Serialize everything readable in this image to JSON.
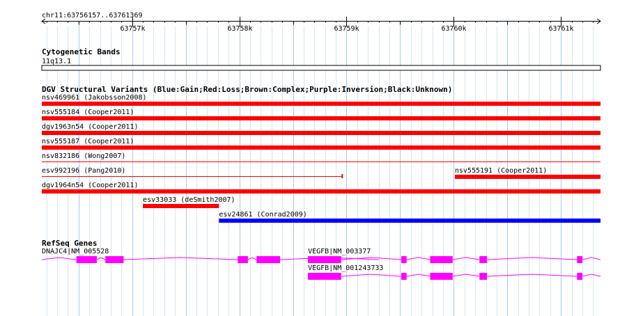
{
  "ruler": {
    "label": "chr11:63756157..63761369",
    "ticks": [
      {
        "value": 63757000,
        "label": "63757k"
      },
      {
        "value": 63758000,
        "label": "63758k"
      },
      {
        "value": 63759000,
        "label": "63759k"
      },
      {
        "value": 63760000,
        "label": "63760k"
      },
      {
        "value": 63761000,
        "label": "63761k"
      }
    ],
    "start": 63756157,
    "end": 63761369
  },
  "cytoband": {
    "title": "Cytogenetic Bands",
    "band_label": "11q13.1"
  },
  "dgv": {
    "title": "DGV Structural Variants (Blue:Gain;Red:Loss;Brown:Complex;Purple:Inversion;Black:Unknown)",
    "variants": [
      {
        "label": "nsv469961 (Jakobsson2008)",
        "color": "#ff0000",
        "start": 63756157,
        "end": 63761369,
        "style": "thick"
      },
      {
        "label": "nsv555184 (Cooper2011)",
        "color": "#ff0000",
        "start": 63756157,
        "end": 63761369,
        "style": "thick"
      },
      {
        "label": "dgv1963n54 (Cooper2011)",
        "color": "#ff0000",
        "start": 63756157,
        "end": 63761369,
        "style": "thick"
      },
      {
        "label": "nsv555187 (Cooper2011)",
        "color": "#ff0000",
        "start": 63756157,
        "end": 63761369,
        "style": "thick"
      },
      {
        "label": "nsv832186 (Wong2007)",
        "color": "#ff0000",
        "start": 63756157,
        "end": 63761369,
        "style": "thin"
      },
      {
        "label": "esv992196 (Pang2010)",
        "color": "#ff0000",
        "start": 63756157,
        "end": 63758960,
        "style": "line"
      },
      {
        "label": "nsv555191 (Cooper2011)",
        "color": "#ff0000",
        "start": 63760010,
        "end": 63761369,
        "style": "thick"
      },
      {
        "label": "dgv1964n54 (Cooper2011)",
        "color": "#ff0000",
        "start": 63756157,
        "end": 63761369,
        "style": "thick"
      },
      {
        "label": "esv33033 (deSmith2007)",
        "color": "#ff0000",
        "start": 63757100,
        "end": 63757810,
        "style": "thick"
      },
      {
        "label": "esv24861 (Conrad2009)",
        "color": "#0000ff",
        "start": 63757810,
        "end": 63761369,
        "style": "thick"
      }
    ]
  },
  "refseq": {
    "title": "RefSeq Genes",
    "color": "#ff00ff",
    "genes": [
      {
        "label": "DNAJC4|NM_005528",
        "start": 63756157,
        "end": 63759300,
        "exons": [
          [
            63756480,
            63756670
          ],
          [
            63756750,
            63756920
          ],
          [
            63757985,
            63758080
          ],
          [
            63758160,
            63758380
          ]
        ]
      },
      {
        "label": "VEGFB|NM_003377",
        "start": 63758640,
        "end": 63761369,
        "exons": [
          [
            63758640,
            63758950
          ],
          [
            63759510,
            63759560
          ],
          [
            63759780,
            63759990
          ],
          [
            63760240,
            63760310
          ],
          [
            63761150,
            63761200
          ]
        ]
      },
      {
        "label": "VEGFB|NM_001243733",
        "start": 63758640,
        "end": 63761369,
        "exons": [
          [
            63758640,
            63758950
          ],
          [
            63759510,
            63759560
          ],
          [
            63759780,
            63759990
          ],
          [
            63760240,
            63760310
          ],
          [
            63761150,
            63761200
          ]
        ]
      }
    ]
  }
}
